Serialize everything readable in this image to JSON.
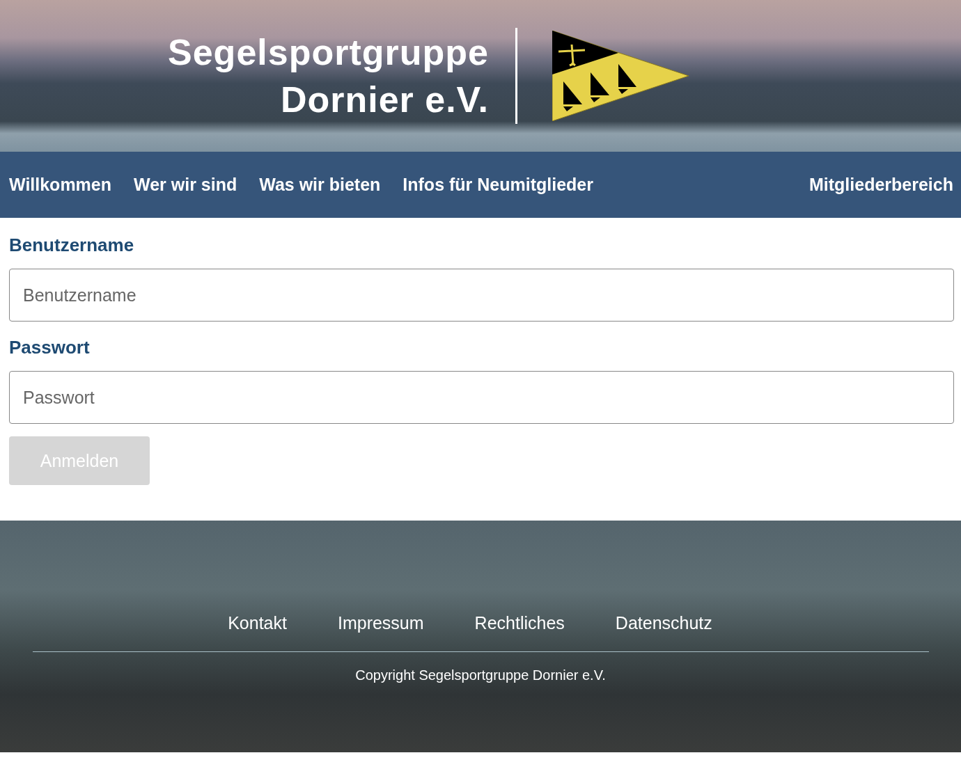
{
  "header": {
    "title_lines": [
      "Segelsportgruppe",
      "Dornier e.V."
    ]
  },
  "nav": {
    "items": [
      {
        "label": "Willkommen"
      },
      {
        "label": "Wer wir sind"
      },
      {
        "label": "Was wir bieten"
      },
      {
        "label": "Infos für Neumitglieder"
      }
    ],
    "right_item": {
      "label": "Mitgliederbereich"
    }
  },
  "login_form": {
    "fields": [
      {
        "label": "Benutzername",
        "placeholder": "Benutzername"
      },
      {
        "label": "Passwort",
        "placeholder": "Passwort"
      }
    ],
    "submit": {
      "label": "Anmelden",
      "disabled": true
    }
  },
  "footer": {
    "links": [
      "Kontakt",
      "Impressum",
      "Rechtliches",
      "Datenschutz"
    ],
    "copyright": "Copyright Segelsportgruppe Dornier e.V."
  }
}
